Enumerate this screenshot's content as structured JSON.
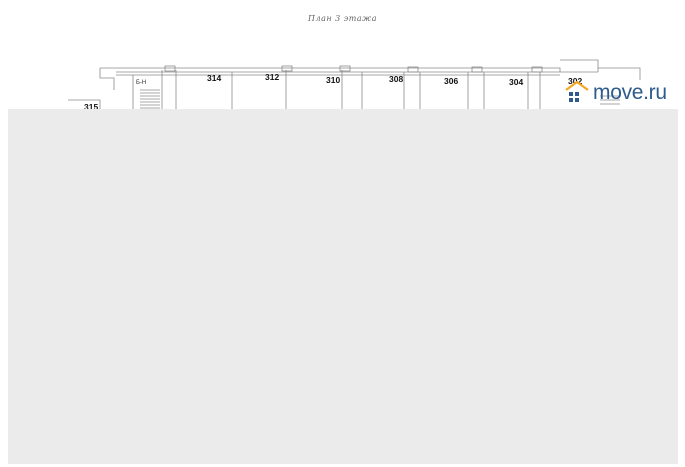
{
  "plan": {
    "title": "План 3 этажа",
    "stair_label": "Б-Н",
    "rooms": [
      {
        "number": "314"
      },
      {
        "number": "312"
      },
      {
        "number": "310"
      },
      {
        "number": "308"
      },
      {
        "number": "306"
      },
      {
        "number": "304"
      },
      {
        "number": "302"
      },
      {
        "number": "315"
      }
    ]
  },
  "logo": {
    "text": "move.ru",
    "brand_color": "#2d5b8c",
    "accent_color": "#f5a623"
  },
  "overlay": {
    "color": "#ebebeb"
  }
}
